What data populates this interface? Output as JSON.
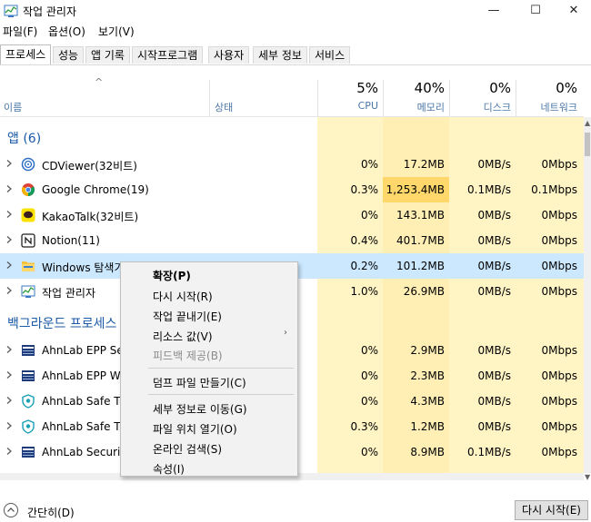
{
  "window": {
    "title": "작업 관리자",
    "controls": {
      "minimize": "—",
      "maximize": "☐",
      "close": "✕"
    }
  },
  "menu": [
    "파일(F)",
    "옵션(O)",
    "보기(V)"
  ],
  "tabs": [
    "프로세스",
    "성능",
    "앱 기록",
    "시작프로그램",
    "사용자",
    "세부 정보",
    "서비스"
  ],
  "header": {
    "sort_arrow": "^",
    "name_label": "이름",
    "status_label": "상태",
    "columns": [
      {
        "pct": "5%",
        "label": "CPU"
      },
      {
        "pct": "40%",
        "label": "메모리"
      },
      {
        "pct": "0%",
        "label": "디스크"
      },
      {
        "pct": "0%",
        "label": "네트워크"
      }
    ]
  },
  "groups": {
    "apps": "앱 (6)",
    "background": "백그라운드 프로세스"
  },
  "app_rows": [
    {
      "name": "CDViewer(32비트)",
      "icon": "cdviewer-icon",
      "cpu": "0%",
      "mem": "17.2MB",
      "disk": "0MB/s",
      "net": "0Mbps"
    },
    {
      "name": "Google Chrome(19)",
      "icon": "chrome-icon",
      "cpu": "0.3%",
      "mem": "1,253.4MB",
      "disk": "0.1MB/s",
      "net": "0.1Mbps"
    },
    {
      "name": "KakaoTalk(32비트)",
      "icon": "kakaotalk-icon",
      "cpu": "0%",
      "mem": "143.1MB",
      "disk": "0MB/s",
      "net": "0Mbps"
    },
    {
      "name": "Notion(11)",
      "icon": "notion-icon",
      "cpu": "0.4%",
      "mem": "401.7MB",
      "disk": "0MB/s",
      "net": "0Mbps"
    },
    {
      "name": "Windows 탐색기",
      "icon": "explorer-icon",
      "cpu": "0.2%",
      "mem": "101.2MB",
      "disk": "0MB/s",
      "net": "0Mbps"
    },
    {
      "name": "작업 관리자",
      "icon": "taskmgr-icon",
      "cpu": "1.0%",
      "mem": "26.9MB",
      "disk": "0MB/s",
      "net": "0Mbps"
    }
  ],
  "bg_rows": [
    {
      "name": "AhnLab EPP Self",
      "icon": "ahnlab-epp-icon",
      "cpu": "0%",
      "mem": "2.9MB",
      "disk": "0MB/s",
      "net": "0Mbps"
    },
    {
      "name": "AhnLab EPP Wa",
      "icon": "ahnlab-epp-icon",
      "cpu": "0%",
      "mem": "2.3MB",
      "disk": "0MB/s",
      "net": "0Mbps"
    },
    {
      "name": "AhnLab Safe Tra",
      "icon": "ahnlab-shield-icon",
      "cpu": "0%",
      "mem": "4.3MB",
      "disk": "0MB/s",
      "net": "0Mbps"
    },
    {
      "name": "AhnLab Safe Tra",
      "icon": "ahnlab-shield-icon",
      "cpu": "0.3%",
      "mem": "1.2MB",
      "disk": "0MB/s",
      "net": "0Mbps"
    },
    {
      "name": "AhnLab Security",
      "icon": "ahnlab-epp-icon",
      "cpu": "0%",
      "mem": "8.9MB",
      "disk": "0.1MB/s",
      "net": "0Mbps"
    }
  ],
  "context_menu": {
    "items": [
      {
        "label": "확장(P)",
        "bold": true
      },
      {
        "label": "다시 시작(R)"
      },
      {
        "label": "작업 끝내기(E)"
      },
      {
        "label": "리소스 값(V)",
        "submenu": true
      },
      {
        "label": "피드백 제공(B)",
        "disabled": true
      },
      {
        "label": "덤프 파일 만들기(C)"
      },
      {
        "label": "세부 정보로 이동(G)"
      },
      {
        "label": "파일 위치 열기(O)"
      },
      {
        "label": "온라인 검색(S)"
      },
      {
        "label": "속성(I)"
      }
    ],
    "submenu_arrow": "›"
  },
  "footer": {
    "brief_label": "간단히(D)",
    "restart_label": "다시 시작(E)"
  },
  "colors": {
    "band_light": "#fff4c4",
    "band_mid": "#ffe9a8",
    "band_strong": "#ffd76a",
    "selected_row": "#cce8ff",
    "group_label": "#1a5aa6"
  }
}
